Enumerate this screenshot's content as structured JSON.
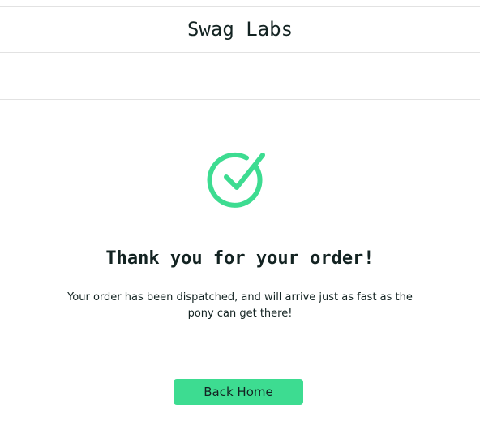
{
  "header": {
    "app_title": "Swag Labs"
  },
  "checkout_complete": {
    "icon": "checkmark-circle-icon",
    "heading": "Thank you for your order!",
    "message": "Your order has been dispatched, and will arrive just as fast as the pony can get there!",
    "back_home_label": "Back Home"
  },
  "colors": {
    "accent": "#3ddc91",
    "text": "#132322",
    "border": "#e2e2e2"
  }
}
